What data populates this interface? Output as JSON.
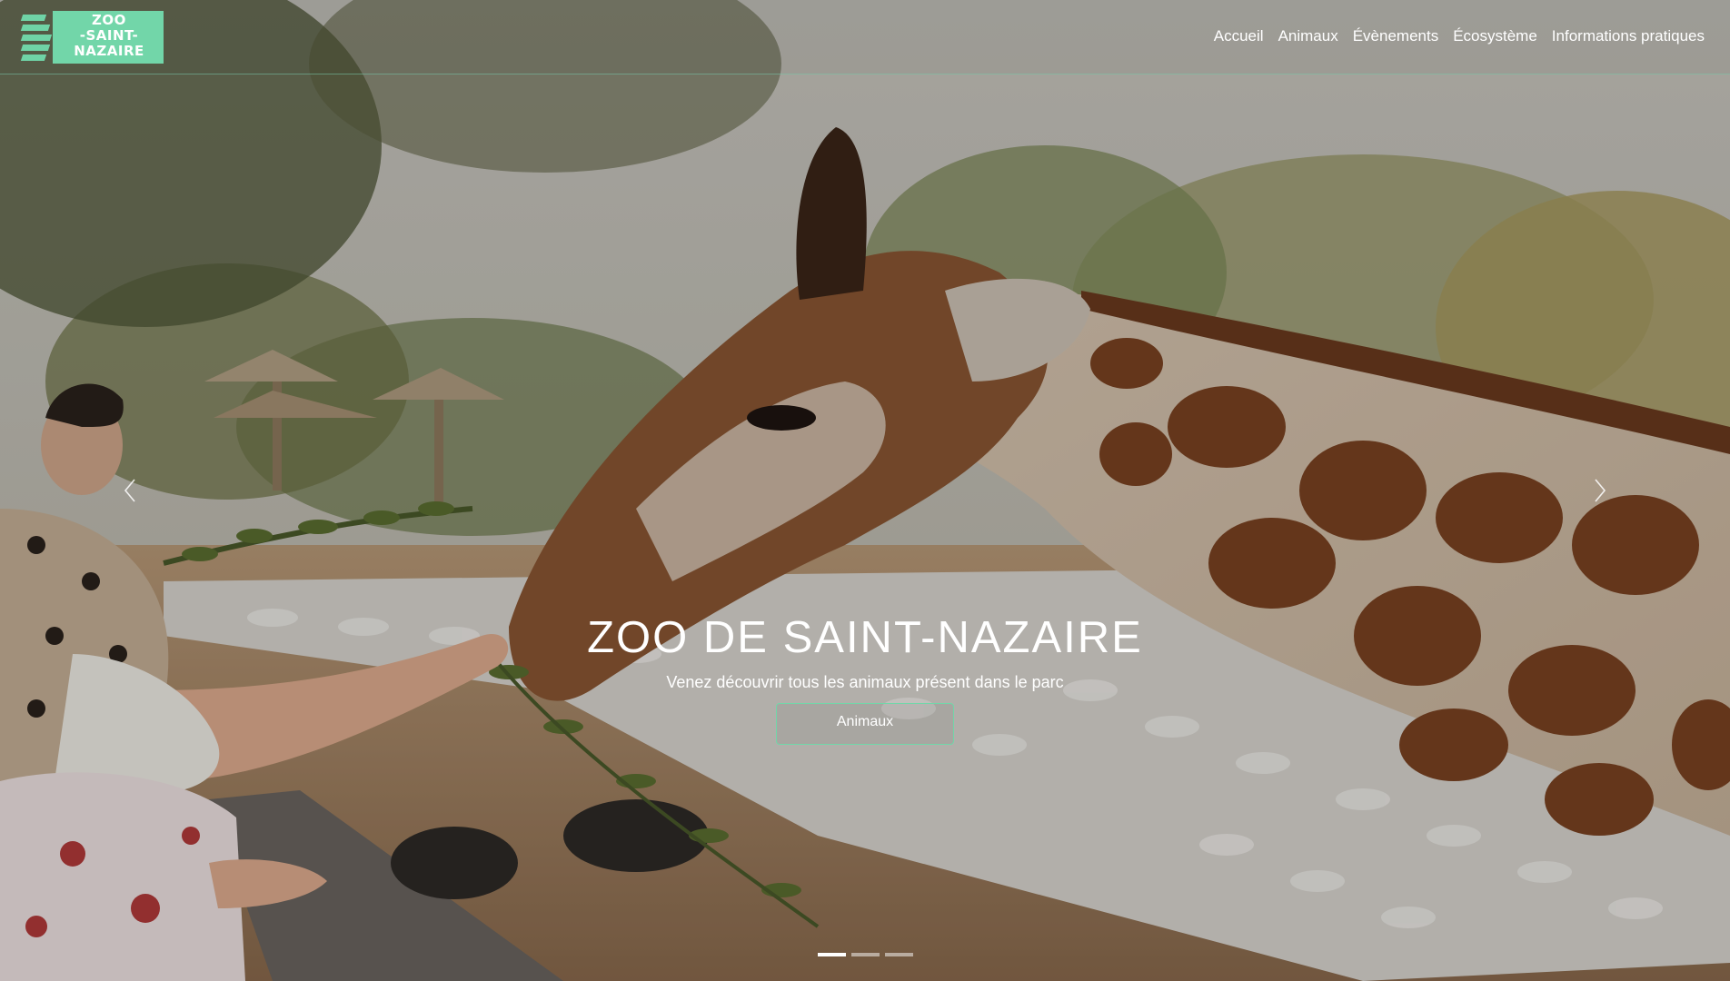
{
  "brand": {
    "logo_lines": [
      "ZOO",
      "-SAINT-",
      "NAZAIRE"
    ],
    "accent_color": "#72d6a9"
  },
  "nav": {
    "items": [
      {
        "label": "Accueil"
      },
      {
        "label": "Animaux"
      },
      {
        "label": "Évènements"
      },
      {
        "label": "Écosystème"
      },
      {
        "label": "Informations pratiques"
      }
    ]
  },
  "hero": {
    "title": "ZOO DE SAINT-NAZAIRE",
    "subtitle": "Venez découvrir tous les animaux présent dans le parc",
    "cta_label": "Animaux",
    "background_icon": "giraffe-photo",
    "slide_count": 3,
    "active_slide": 1
  },
  "controls": {
    "prev_icon": "chevron-left-icon",
    "next_icon": "chevron-right-icon"
  }
}
